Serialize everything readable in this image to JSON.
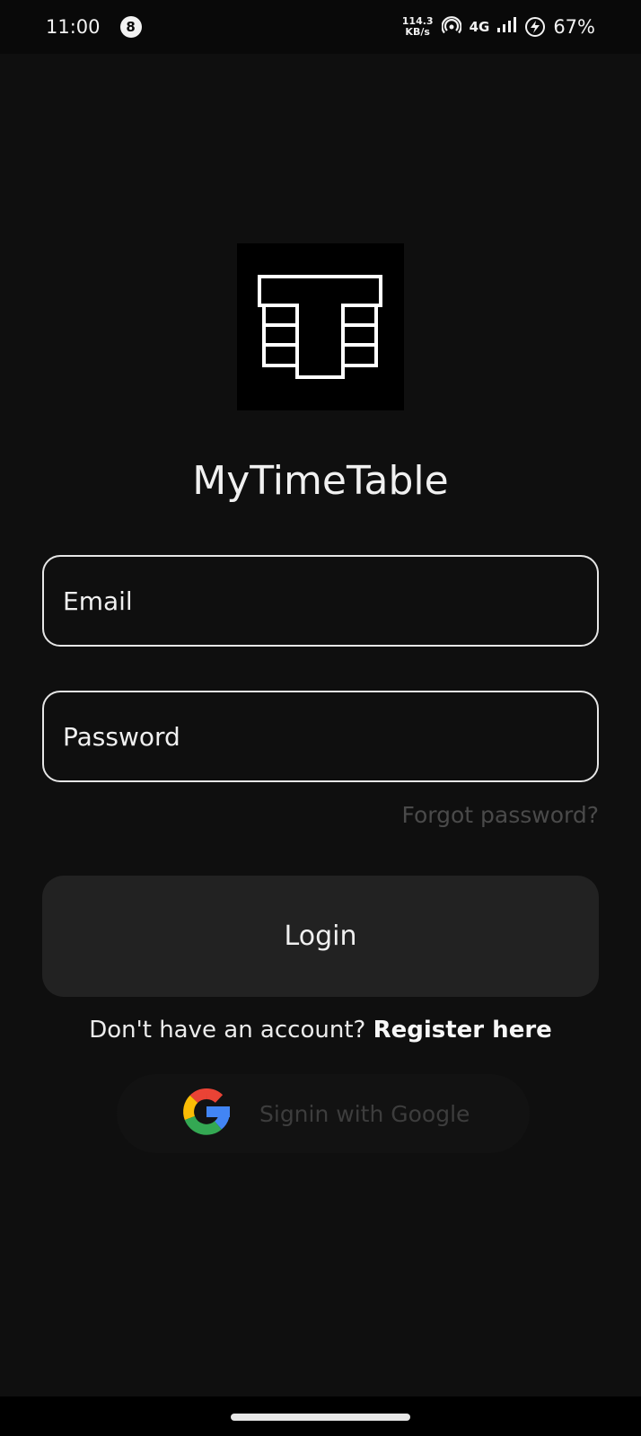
{
  "status_bar": {
    "time": "11:00",
    "notification_count": "8",
    "speed_value": "114.3",
    "speed_unit": "KB/s",
    "network": "4G",
    "battery": "67%"
  },
  "app": {
    "title": "MyTimeTable",
    "logo_icon": "timetable-logo-icon"
  },
  "form": {
    "email_placeholder": "Email",
    "email_value": "",
    "password_placeholder": "Password",
    "password_value": "",
    "forgot_label": "Forgot password?",
    "login_label": "Login"
  },
  "register": {
    "prompt": "Don't have an account? ",
    "link_label": "Register here"
  },
  "google": {
    "label": "Signin with Google",
    "icon": "google-icon"
  },
  "colors": {
    "background": "#0f0f0f",
    "button": "#222222",
    "muted_text": "#4a4a4a"
  }
}
